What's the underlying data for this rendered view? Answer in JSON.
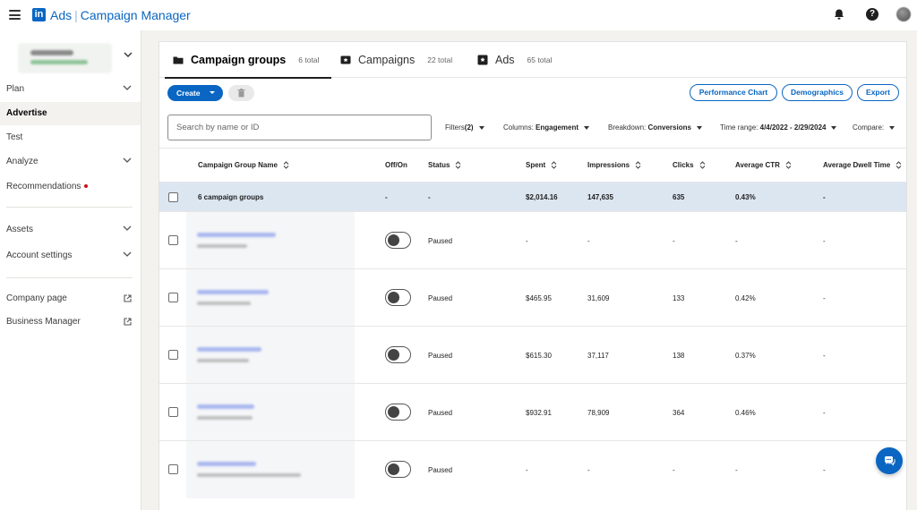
{
  "header": {
    "logo": "in",
    "brand_product": "Ads",
    "brand_app": "Campaign Manager"
  },
  "sidebar": {
    "nav": [
      {
        "label": "Plan",
        "chevron": true
      },
      {
        "label": "Advertise",
        "active": true
      },
      {
        "label": "Test"
      },
      {
        "label": "Analyze",
        "chevron": true
      },
      {
        "label": "Recommendations",
        "badge_dot": true
      }
    ],
    "nav2": [
      {
        "label": "Assets",
        "chevron": true
      },
      {
        "label": "Account settings",
        "chevron": true
      }
    ],
    "links": [
      {
        "label": "Company page",
        "icon": "external-link-icon"
      },
      {
        "label": "Business Manager",
        "icon": "external-link-icon"
      }
    ]
  },
  "tabs": [
    {
      "label": "Campaign groups",
      "count": "6 total",
      "icon": "folder-icon",
      "active": true
    },
    {
      "label": "Campaigns",
      "count": "22 total",
      "icon": "campaign-icon"
    },
    {
      "label": "Ads",
      "count": "65 total",
      "icon": "ad-icon"
    }
  ],
  "toolbar": {
    "create_label": "Create",
    "performance_chart_label": "Performance Chart",
    "demographics_label": "Demographics",
    "export_label": "Export"
  },
  "filters": {
    "search_placeholder": "Search by name or ID",
    "filters_label": "Filters",
    "filters_count": "(2)",
    "columns_label": "Columns:",
    "columns_value": "Engagement",
    "breakdown_label": "Breakdown:",
    "breakdown_value": "Conversions",
    "time_range_label": "Time range:",
    "time_range_value": "4/4/2022 - 2/29/2024",
    "compare_label": "Compare:"
  },
  "table": {
    "columns": [
      "Campaign Group Name",
      "Off/On",
      "Status",
      "Spent",
      "Impressions",
      "Clicks",
      "Average CTR",
      "Average Dwell Time"
    ],
    "summary": {
      "name": "6 campaign groups",
      "toggle": "-",
      "status": "-",
      "spent": "$2,014.16",
      "impressions": "147,635",
      "clicks": "635",
      "ctr": "0.43%",
      "dwell": "-"
    },
    "rows": [
      {
        "status": "Paused",
        "spent": "-",
        "impressions": "-",
        "clicks": "-",
        "ctr": "-",
        "dwell": "-"
      },
      {
        "status": "Paused",
        "spent": "$465.95",
        "impressions": "31,609",
        "clicks": "133",
        "ctr": "0.42%",
        "dwell": "-"
      },
      {
        "status": "Paused",
        "spent": "$615.30",
        "impressions": "37,117",
        "clicks": "138",
        "ctr": "0.37%",
        "dwell": "-"
      },
      {
        "status": "Paused",
        "spent": "$932.91",
        "impressions": "78,909",
        "clicks": "364",
        "ctr": "0.46%",
        "dwell": "-"
      },
      {
        "status": "Paused",
        "spent": "-",
        "impressions": "-",
        "clicks": "-",
        "ctr": "-",
        "dwell": "-"
      }
    ]
  },
  "colors": {
    "brand_blue": "#0a66c2",
    "summary_row_bg": "#dce6f1",
    "notification_dot": "#cc1016"
  }
}
